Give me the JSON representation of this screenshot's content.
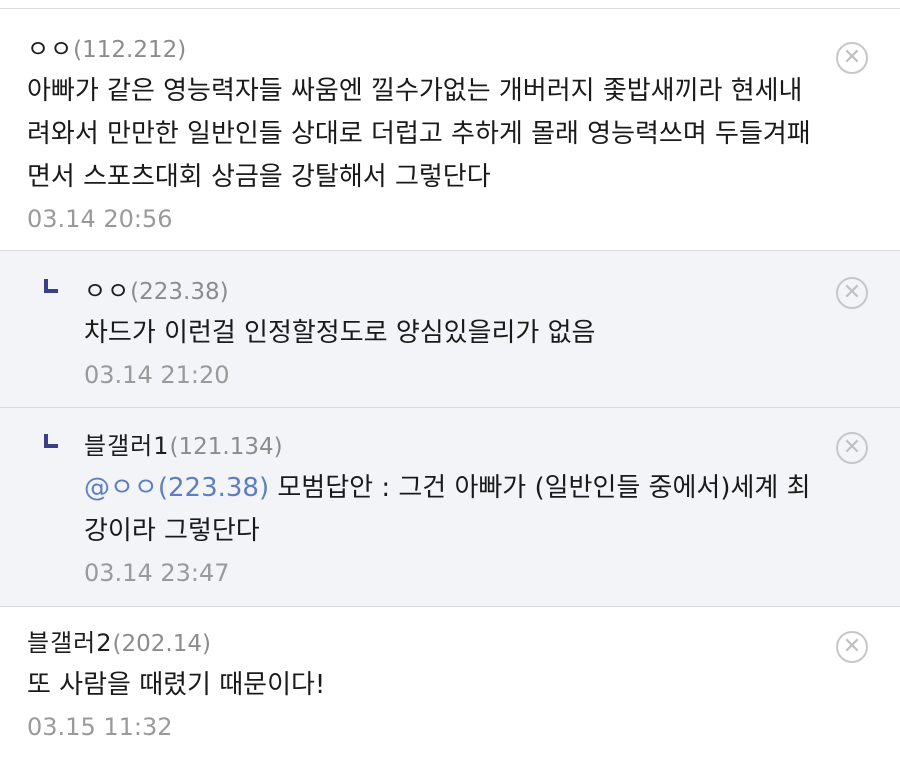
{
  "comments": [
    {
      "nick": "ㅇㅇ",
      "ip": "(112.212)",
      "text": "아빠가 같은 영능력자들 싸움엔 낄수가없는 개버러지 좇밥새끼라 현세내려와서 만만한 일반인들 상대로 더럽고 추하게 몰래 영능력쓰며 두들겨패면서 스포츠대회 상금을 강탈해서 그렇단다",
      "time": "03.14 20:56",
      "delete_icon": "circle-x-icon"
    },
    {
      "nick": "ㅇㅇ",
      "ip": "(223.38)",
      "text": "차드가 이런걸 인정할정도로 양심있을리가 없음",
      "time": "03.14 21:20",
      "reply_icon": "reply-corner-icon",
      "delete_icon": "circle-x-icon"
    },
    {
      "nick": "블갤러1",
      "ip": "(121.134)",
      "mention": "@ㅇㅇ(223.38)",
      "text": " 모범답안 : 그건 아빠가 (일반인들 중에서)세계 최강이라 그렇단다",
      "time": "03.14 23:47",
      "reply_icon": "reply-corner-icon",
      "delete_icon": "circle-x-icon"
    },
    {
      "nick": "블갤러2",
      "ip": "(202.14)",
      "text": "또 사람을 때렸기 때문이다!",
      "time": "03.15 11:32",
      "delete_icon": "circle-x-icon"
    }
  ],
  "colors": {
    "reply_background": "#f3f4f7",
    "mention": "#5d7fbf",
    "reply_marker": "#3d3f86",
    "muted_text": "#9a9a9a"
  }
}
